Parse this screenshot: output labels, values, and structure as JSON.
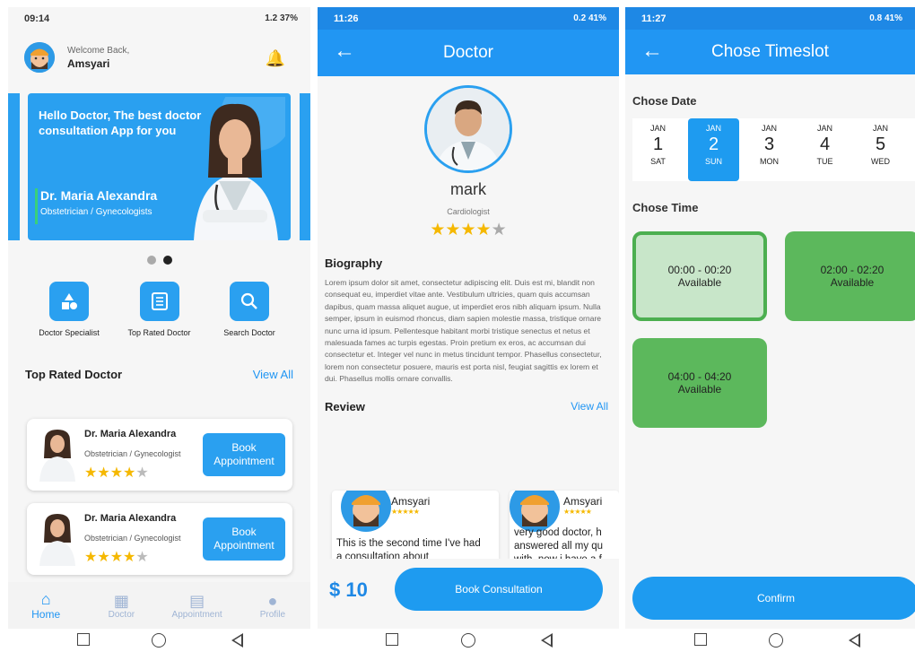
{
  "phone1": {
    "status": {
      "time": "09:14",
      "right": "1.2 37%"
    },
    "header": {
      "welcome": "Welcome Back,",
      "user": "Amsyari"
    },
    "banner": {
      "headline": "Hello Doctor, The best doctor consultation App for you",
      "doctor": "Dr. Maria Alexandra",
      "specialty": "Obstetrician / Gynecologists"
    },
    "menu": [
      {
        "label": "Doctor Specialist",
        "icon": "shapes-icon"
      },
      {
        "label": "Top Rated Doctor",
        "icon": "list-icon"
      },
      {
        "label": "Search Doctor",
        "icon": "search-icon"
      }
    ],
    "section": {
      "title": "Top Rated Doctor",
      "view_all": "View All"
    },
    "cards": [
      {
        "name": "Dr. Maria Alexandra",
        "specialty": "Obstetrician / Gynecologist",
        "button": "Book Appointment",
        "rating": 4.5
      },
      {
        "name": "Dr. Maria Alexandra",
        "specialty": "Obstetrician / Gynecologist",
        "button": "Book Appointment",
        "rating": 4.5
      }
    ],
    "nav": [
      {
        "label": "Home",
        "icon": "home-icon"
      },
      {
        "label": "Doctor",
        "icon": "doctor-icon"
      },
      {
        "label": "Appointment",
        "icon": "chat-icon"
      },
      {
        "label": "Profile",
        "icon": "person-icon"
      }
    ]
  },
  "phone2": {
    "status": {
      "time": "11:26",
      "right": "0.2 41%"
    },
    "title": "Doctor",
    "name": "mark",
    "specialty": "Cardiologist",
    "rating": 4.5,
    "bio_title": "Biography",
    "bio": "Lorem ipsum dolor sit amet, consectetur adipiscing elit. Duis est mi, blandit non consequat eu, imperdiet vitae ante. Vestibulum ultricies, quam quis accumsan dapibus, quam massa aliquet augue, ut imperdiet eros nibh aliquam ipsum. Nulla semper, ipsum in euismod rhoncus, diam sapien molestie massa, tristique ornare nunc urna id ipsum. Pellentesque habitant morbi tristique senectus et netus et malesuada fames ac turpis egestas. Proin pretium ex eros, ac accumsan dui consectetur et. Integer vel nunc in metus tincidunt tempor. Phasellus consectetur, lorem non consectetur posuere, mauris est porta nisl, feugiat sagittis ex lorem et dui. Phasellus mollis ornare convallis.",
    "review_title": "Review",
    "view_all": "View All",
    "reviews": [
      {
        "name": "Amsyari",
        "text": "This is the second time I've had a consultation about"
      },
      {
        "name": "Amsyari",
        "text": "very good doctor, h answered all my qu with, now i have a f"
      }
    ],
    "price": "$ 10",
    "book": "Book Consultation"
  },
  "phone3": {
    "status": {
      "time": "11:27",
      "right": "0.8 41%"
    },
    "title": "Chose Timeslot",
    "date_label": "Chose Date",
    "dates": [
      {
        "m": "JAN",
        "d": "1",
        "w": "SAT"
      },
      {
        "m": "JAN",
        "d": "2",
        "w": "SUN"
      },
      {
        "m": "JAN",
        "d": "3",
        "w": "MON"
      },
      {
        "m": "JAN",
        "d": "4",
        "w": "TUE"
      },
      {
        "m": "JAN",
        "d": "5",
        "w": "WED"
      }
    ],
    "time_label": "Chose Time",
    "slots": [
      {
        "time": "00:00 - 00:20",
        "status": "Available"
      },
      {
        "time": "02:00 - 02:20",
        "status": "Available"
      },
      {
        "time": "04:00 - 04:20",
        "status": "Available"
      }
    ],
    "confirm": "Confirm"
  },
  "colors": {
    "primary": "#2196f3",
    "slot": "#5cb85c",
    "slot_selected": "#c8e6c9",
    "star": "#f5b800"
  }
}
